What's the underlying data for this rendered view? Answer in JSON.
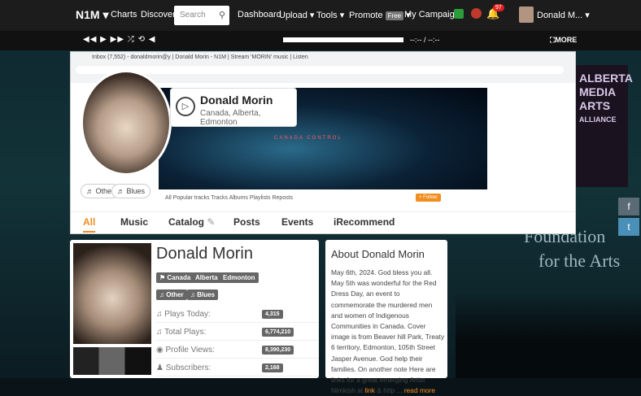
{
  "topnav": {
    "logo": "N1M",
    "charts": "Charts",
    "discover": "Discover",
    "search_placeholder": "Search",
    "dashboard": "Dashboard",
    "upload": "Upload",
    "tools": "Tools",
    "promote": "Promote",
    "promote_badge": "Free",
    "campaigns": "My Campaigns",
    "notif_count": "97",
    "user": "Donald M..."
  },
  "player": {
    "controls": "◀◀ ▶ ▶▶ ⤮ ⟲ ◀",
    "time": "--:-- / --:--",
    "more": "⛶MORE"
  },
  "banner": {
    "name": "Donald Morin",
    "location": "Canada, Alberta, Edmonton",
    "tags": [
      "♬ Other",
      "♬ Blues"
    ],
    "subnav": "All   Popular tracks   Tracks   Albums   Playlists   Reposts",
    "follow": "+ Follow",
    "cover_text": "CANADA   CONTROL",
    "tabs": [
      "All",
      "Music",
      "Catalog",
      "Posts",
      "Events",
      "iRecommend"
    ],
    "browser_tabs": "Inbox (7,552) - donaldmorin@y   |   Donald Morin - N1M   |   Stream 'MORIN' music | Listen"
  },
  "promo": {
    "lines": [
      "ALBERTA",
      "MEDIA",
      "ARTS",
      "ALLIANCE"
    ],
    "foundation_line1": "Foundation",
    "foundation_line2": "for the Arts"
  },
  "profile": {
    "name": "Donald Morin",
    "locations": [
      "Canada",
      "Alberta",
      "Edmonton"
    ],
    "genres": [
      "Other",
      "Blues"
    ],
    "stats": [
      {
        "label": "Plays Today:",
        "value": "4,315"
      },
      {
        "label": "Total Plays:",
        "value": "6,774,210"
      },
      {
        "label": "Profile Views:",
        "value": "8,390,230"
      },
      {
        "label": "Subscribers:",
        "value": "2,168"
      }
    ]
  },
  "about": {
    "title": "About Donald Morin",
    "text": "May 6th, 2024. God bless you all. May 5th was wonderful for the Red Dress Day, an event to commemorate the murdered men and women of Indigenous Communities in Canada. Cover image is from Beaver hill Park, Treaty 6 territory, Edmonton, 105th Street Jasper Avenue. God help their families. On another note Here are links for a great emerging Artist Nimkish at",
    "link1": "link",
    "amp": " & http ...",
    "read_more": "read more"
  },
  "social": {
    "facebook": "f",
    "twitter": "t"
  }
}
